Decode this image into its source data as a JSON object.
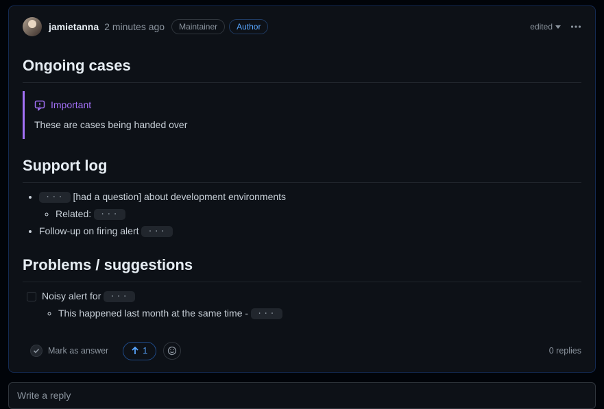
{
  "header": {
    "username": "jamietanna",
    "timestamp": "2 minutes ago",
    "badges": {
      "maintainer": "Maintainer",
      "author": "Author"
    },
    "edited": "edited"
  },
  "sections": {
    "ongoing_title": "Ongoing cases",
    "callout": {
      "label": "Important",
      "body": "These are cases being handed over"
    },
    "support_title": "Support log",
    "support": {
      "item1_text": " [had a question] about development environments",
      "item1_sub_prefix": "Related: ",
      "item2_prefix": "Follow-up on firing alert "
    },
    "problems_title": "Problems / suggestions",
    "problems": {
      "task_prefix": "Noisy alert for ",
      "task_sub_prefix": "This happened last month at the same time - "
    }
  },
  "actions": {
    "mark_answer": "Mark as answer",
    "upvotes": "1",
    "replies": "0 replies"
  },
  "reply_placeholder": "Write a reply",
  "chip": "..."
}
